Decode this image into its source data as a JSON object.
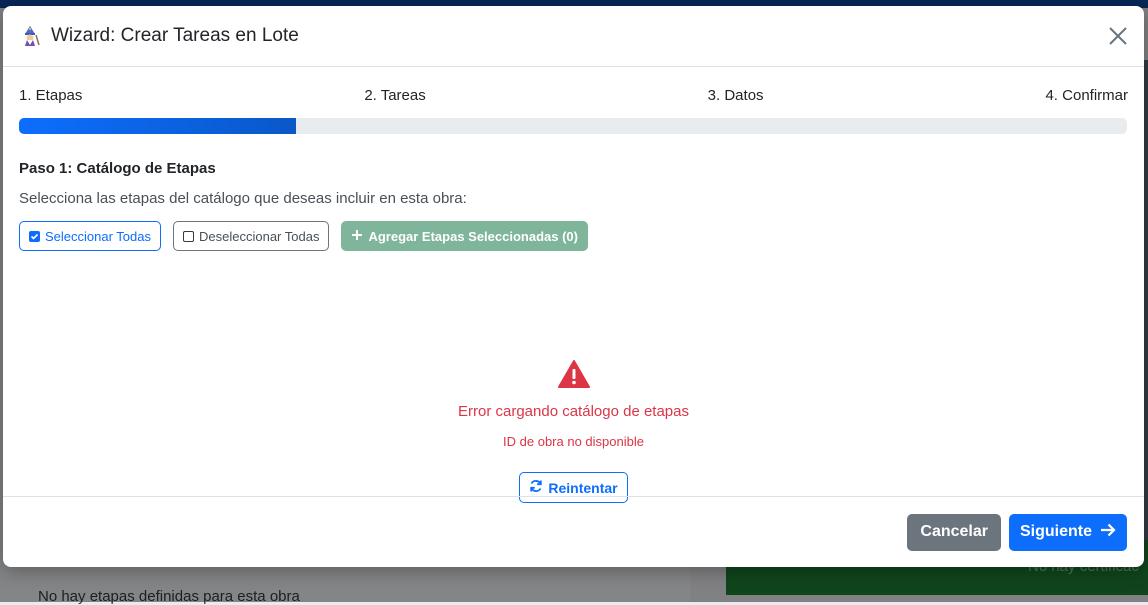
{
  "background": {
    "left_text": "No hay etapas definidas para esta obra",
    "right_text": "No hay certificac"
  },
  "modal": {
    "title": "Wizard: Crear Tareas en Lote",
    "icon": "wizard-icon",
    "close_icon": "close-icon"
  },
  "steps": [
    {
      "label": "1. Etapas"
    },
    {
      "label": "2. Tareas"
    },
    {
      "label": "3. Datos"
    },
    {
      "label": "4. Confirmar"
    }
  ],
  "progress": {
    "value_percent": 25
  },
  "step1": {
    "title": "Paso 1: Catálogo de Etapas",
    "description": "Selecciona las etapas del catálogo que deseas incluir en esta obra:",
    "select_all_label": "Seleccionar Todas",
    "deselect_all_label": "Deseleccionar Todas",
    "add_selected_label": "Agregar Etapas Seleccionadas (0)"
  },
  "error": {
    "title": "Error cargando catálogo de etapas",
    "detail": "ID de obra no disponible",
    "retry_label": "Reintentar"
  },
  "footer": {
    "cancel_label": "Cancelar",
    "next_label": "Siguiente"
  },
  "colors": {
    "primary": "#0d6efd",
    "danger": "#dc3545",
    "secondary": "#6c757d",
    "success_disabled": "#79b295"
  }
}
